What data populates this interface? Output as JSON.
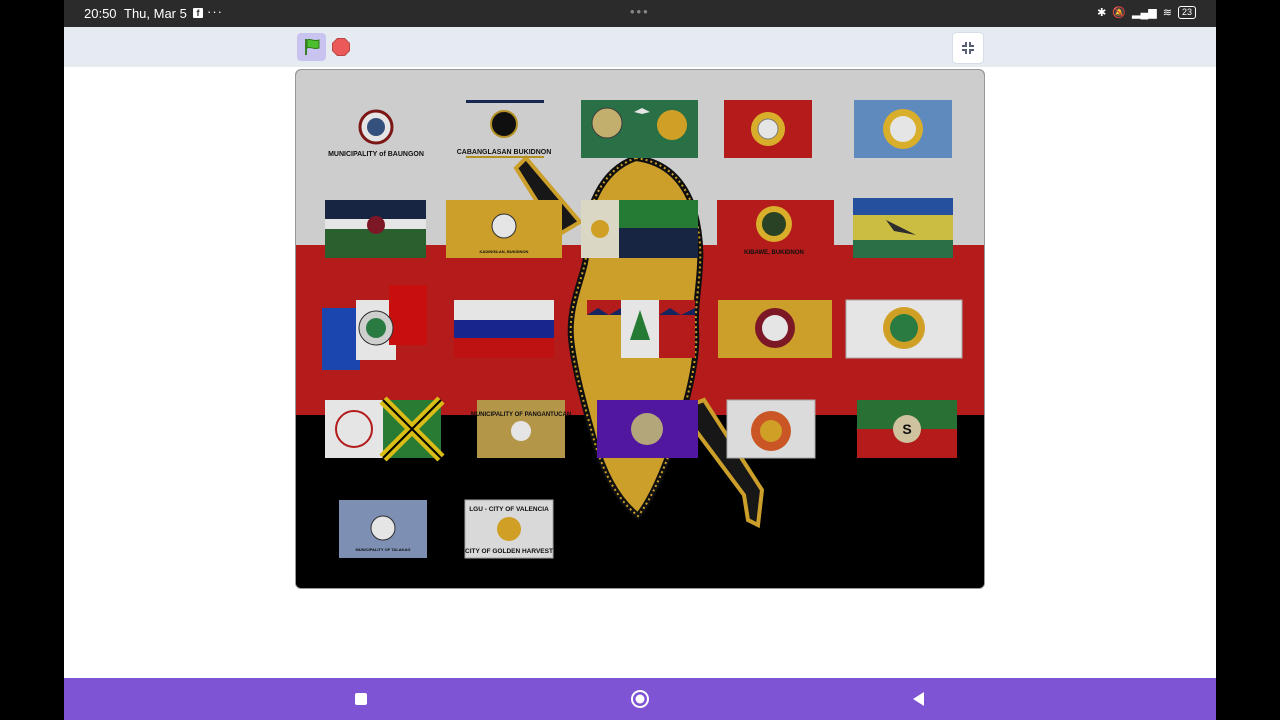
{
  "status_bar": {
    "time": "20:50",
    "date": "Thu, Mar 5",
    "notification_icon": "facebook-icon",
    "more": "···",
    "battery": "23"
  },
  "toolbar": {
    "green_flag_icon": "green-flag-icon",
    "stop_icon": "stop-sign-icon",
    "fullscreen_icon": "exit-fullscreen-icon"
  },
  "stage": {
    "background_colors": [
      "#e5e5e5",
      "#c8201e",
      "#000000"
    ],
    "flags": {
      "baungon": "MUNICIPALITY of BAUNGON",
      "cabanglasan": "CABANGLASAN  BUKIDNON",
      "kadingilan_sub": "KADINGILAN, BUKIDNON",
      "kibawe": "KIBAWE, BUKIDNON",
      "pangantucan": "MUNICIPALITY OF PANGANTUCAN",
      "talakag": "MUNICIPALITY OF TALAKAG",
      "valencia_top": "LGU - CITY OF VALENCIA",
      "valencia_bottom": "CITY OF GOLDEN HARVEST",
      "sumilao_letter": "S"
    }
  },
  "nav_bar": {
    "recents_icon": "recents-square-icon",
    "home_icon": "home-circle-icon",
    "back_icon": "back-triangle-icon"
  }
}
